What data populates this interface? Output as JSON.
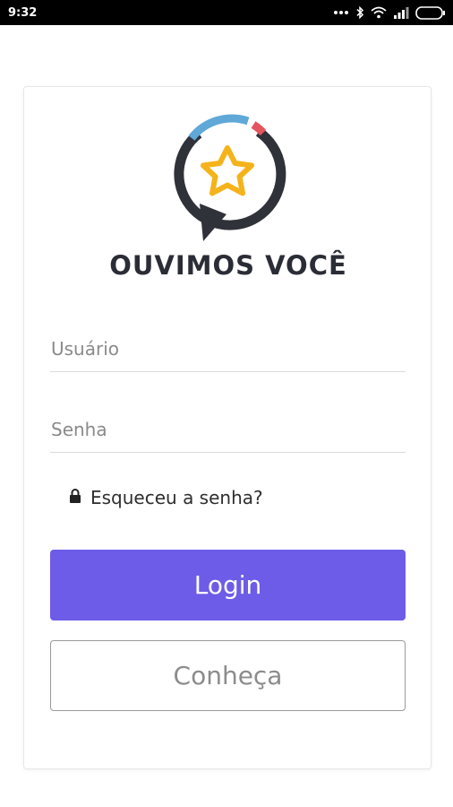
{
  "status_bar": {
    "time": "9:32",
    "icons": [
      "more-dots-icon",
      "bluetooth-icon",
      "wifi-icon",
      "signal-icon",
      "battery-icon"
    ]
  },
  "brand": {
    "name": "OUVIMOS VOCÊ",
    "logo_icon": "speech-bubble-star-icon",
    "colors": {
      "ring": "#2f3239",
      "blue_arc": "#5fa8d8",
      "red_arc": "#e5555e",
      "star": "#f5b31b"
    }
  },
  "login_form": {
    "username_placeholder": "Usuário",
    "password_placeholder": "Senha",
    "forgot_password": "Esqueceu a senha?",
    "forgot_icon": "lock-icon",
    "login_label": "Login",
    "conheca_label": "Conheça"
  },
  "colors": {
    "primary": "#6c5ce7"
  }
}
